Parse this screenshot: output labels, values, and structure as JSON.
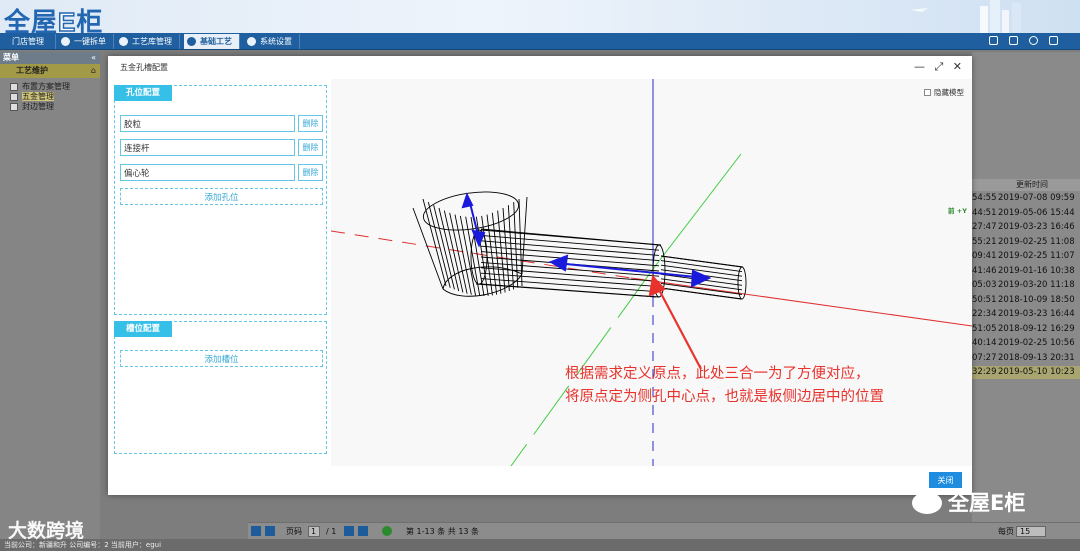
{
  "app": {
    "logo_prefix": "全屋",
    "logo_e": "E",
    "logo_suffix": "柜"
  },
  "menu": [
    {
      "label": "门店管理"
    },
    {
      "label": "一键拆单"
    },
    {
      "label": "工艺库管理"
    },
    {
      "label": "基础工艺",
      "active": true
    },
    {
      "label": "系统设置"
    }
  ],
  "sidebar": {
    "header": "菜单",
    "header_collapse": "«",
    "section": "工艺维护",
    "section_icon": "⌂",
    "items": [
      {
        "label": "布置方案管理"
      },
      {
        "label": "五金管理",
        "selected": true
      },
      {
        "label": "封边管理"
      }
    ]
  },
  "grid": {
    "column_header": "更新时间",
    "rows": [
      {
        "a": "54:55",
        "b": "2019-07-08 09:59"
      },
      {
        "a": "44:51",
        "b": "2019-05-06 15:44"
      },
      {
        "a": "27:47",
        "b": "2019-03-23 16:46"
      },
      {
        "a": "55:21",
        "b": "2019-02-25 11:08"
      },
      {
        "a": "09:41",
        "b": "2019-02-25 11:07"
      },
      {
        "a": "41:46",
        "b": "2019-01-16 10:38"
      },
      {
        "a": "05:03",
        "b": "2019-03-20 11:18"
      },
      {
        "a": "50:51",
        "b": "2018-10-09 18:50"
      },
      {
        "a": "22:34",
        "b": "2019-03-23 16:44"
      },
      {
        "a": "51:05",
        "b": "2018-09-12 16:29"
      },
      {
        "a": "40:14",
        "b": "2019-02-25 10:56"
      },
      {
        "a": "07:27",
        "b": "2018-09-13 20:31"
      },
      {
        "a": "32:29",
        "b": "2019-05-10 10:23"
      }
    ]
  },
  "pager": {
    "page_label": "页码",
    "page_value": "1",
    "page_total": "/ 1",
    "range": "第 1-13 条 共 13 条",
    "per_page_label": "每页",
    "per_page_value": "15"
  },
  "statusbar": {
    "text": "当前公司：新疆和升    公司编号：2    当前用户：egui"
  },
  "dialog": {
    "title": "五金孔槽配置",
    "minimize": "—",
    "maximize": "⤢",
    "close": "✕",
    "hole_section": {
      "title": "孔位配置",
      "holes": [
        {
          "name": "胶粒",
          "delete": "删除"
        },
        {
          "name": "连接杆",
          "delete": "删除"
        },
        {
          "name": "偏心轮",
          "delete": "删除"
        }
      ],
      "add_label": "添加孔位"
    },
    "slot_section": {
      "title": "槽位配置",
      "add_label": "添加槽位"
    },
    "viewport": {
      "hide_model_label": "隐藏模型",
      "axis_label": "前 +Y",
      "annotation_line1": "根据需求定义原点，此处三合一为了方便对应，",
      "annotation_line2": "将原点定为侧孔中心点，也就是板侧边居中的位置"
    },
    "close_button": "关闭"
  },
  "watermarks": {
    "wm1": "全屋E柜",
    "wm2": "大数跨境"
  },
  "colors": {
    "menu_bar": "#1f5f9f",
    "accent": "#36bfe7",
    "close_button": "#1f8ce0",
    "annotation": "#e8332d"
  }
}
